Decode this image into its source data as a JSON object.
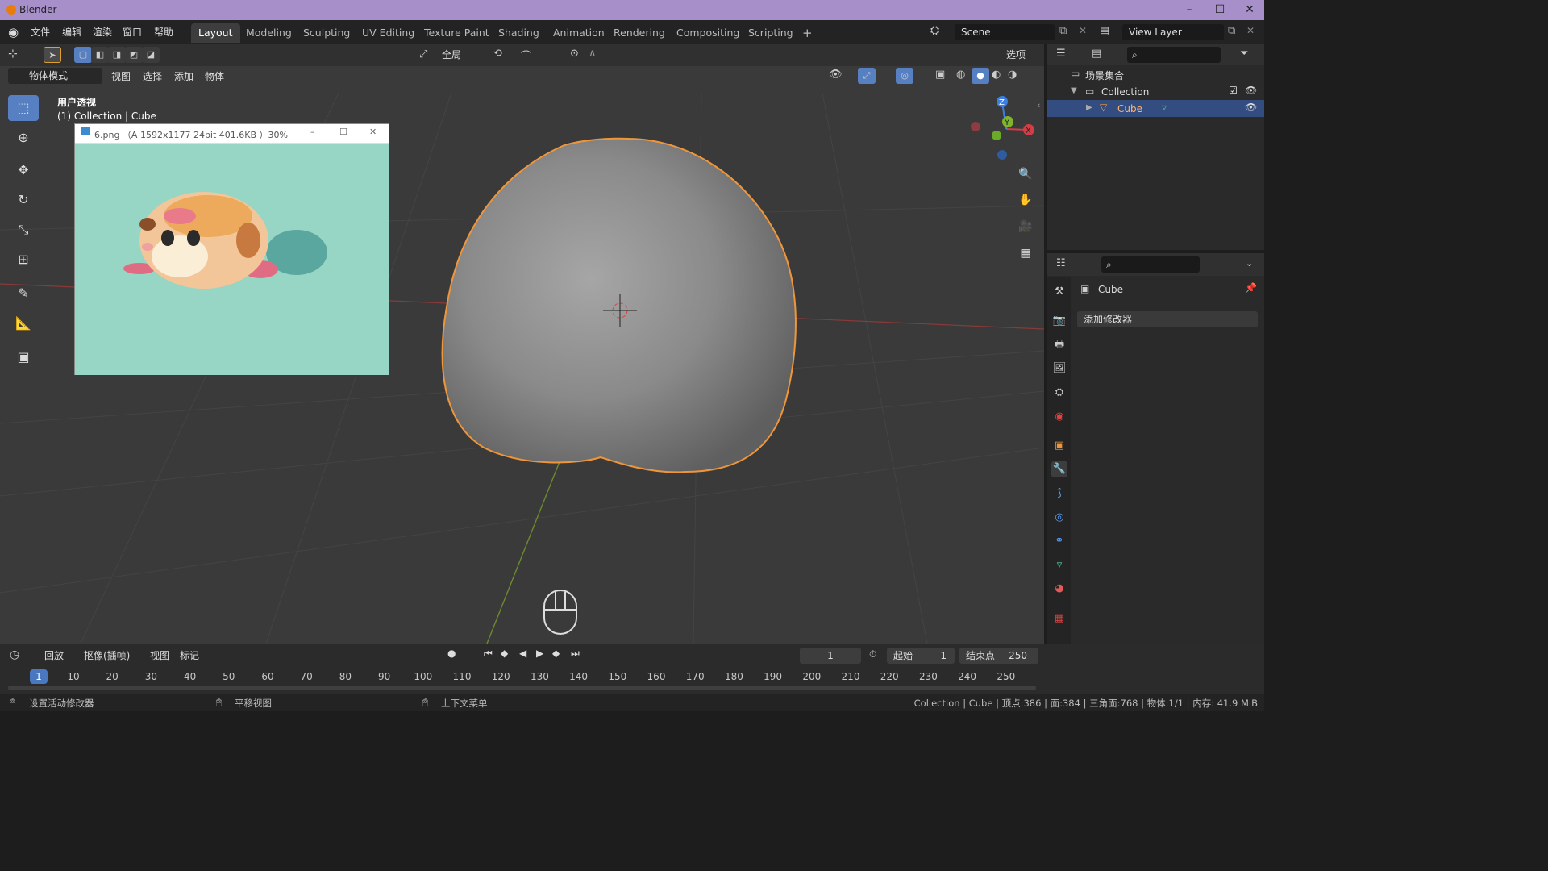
{
  "window": {
    "title": "Blender",
    "minimize": "–",
    "maximize": "☐",
    "close": "✕"
  },
  "menu": {
    "file": "文件",
    "edit": "编辑",
    "render": "渲染",
    "window": "窗口",
    "help": "帮助"
  },
  "workspaces": [
    "Layout",
    "Modeling",
    "Sculpting",
    "UV Editing",
    "Texture Paint",
    "Shading",
    "Animation",
    "Rendering",
    "Compositing",
    "Scripting"
  ],
  "add_workspace": "+",
  "scene": {
    "name": "Scene",
    "view_layer": "View Layer"
  },
  "toolheader": {
    "transform_orientation": "全局",
    "options": "选项"
  },
  "viewheader": {
    "mode": "物体模式",
    "view": "视图",
    "select": "选择",
    "add": "添加",
    "object": "物体"
  },
  "viewport": {
    "perspective": "用户透视",
    "collection_info": "(1) Collection | Cube"
  },
  "image_window": {
    "title": "6.png （A  1592x1177  24bit  401.6KB ）30%"
  },
  "gizmo": {
    "x": "X",
    "y": "Y",
    "z": "Z"
  },
  "outliner": {
    "scene_collection": "场景集合",
    "collection": "Collection",
    "cube": "Cube"
  },
  "properties": {
    "object_name": "Cube",
    "add_modifier": "添加修改器"
  },
  "timeline": {
    "playback": "回放",
    "keying": "抠像(插帧)",
    "view": "视图",
    "marker": "标记",
    "current_frame": "1",
    "start_label": "起始",
    "start": "1",
    "end_label": "结束点",
    "end": "250",
    "ticks": [
      "1",
      "10",
      "20",
      "30",
      "40",
      "50",
      "60",
      "70",
      "80",
      "90",
      "100",
      "110",
      "120",
      "130",
      "140",
      "150",
      "160",
      "170",
      "180",
      "190",
      "200",
      "210",
      "220",
      "230",
      "240",
      "250"
    ]
  },
  "status": {
    "left": "设置活动修改器",
    "middle": "平移视图",
    "right_ctx": "上下文菜单",
    "stats": "Collection | Cube | 顶点:386 | 面:384 | 三角面:768 | 物体:1/1 | 内存: 41.9 MiB"
  },
  "colors": {
    "accent": "#5680c2",
    "selection": "#ffa033",
    "titlebar": "#a78fc9",
    "image_bg": "#97d6c4"
  }
}
